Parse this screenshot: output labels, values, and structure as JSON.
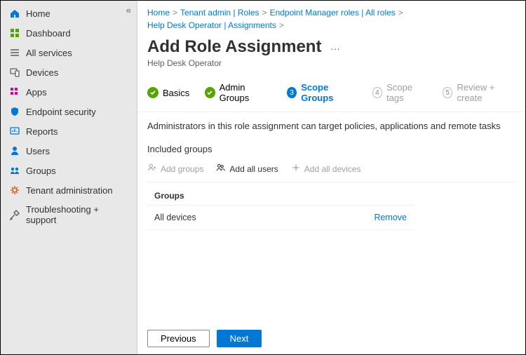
{
  "sidebar": {
    "items": [
      {
        "label": "Home",
        "icon": "home",
        "color": "#0078d4"
      },
      {
        "label": "Dashboard",
        "icon": "dashboard",
        "color": "#57a300"
      },
      {
        "label": "All services",
        "icon": "allservices",
        "color": "#605e5c"
      },
      {
        "label": "Devices",
        "icon": "devices",
        "color": "#605e5c"
      },
      {
        "label": "Apps",
        "icon": "apps",
        "color": "#e3008c"
      },
      {
        "label": "Endpoint security",
        "icon": "shield",
        "color": "#0078d4"
      },
      {
        "label": "Reports",
        "icon": "reports",
        "color": "#0078d4"
      },
      {
        "label": "Users",
        "icon": "users",
        "color": "#0078d4"
      },
      {
        "label": "Groups",
        "icon": "groups",
        "color": "#0078d4"
      },
      {
        "label": "Tenant administration",
        "icon": "tenant",
        "color": "#d83b01"
      },
      {
        "label": "Troubleshooting + support",
        "icon": "tools",
        "color": "#605e5c"
      }
    ]
  },
  "breadcrumb": [
    "Home",
    "Tenant admin | Roles",
    "Endpoint Manager roles | All roles",
    "Help Desk Operator | Assignments"
  ],
  "header": {
    "title": "Add Role Assignment",
    "subtitle": "Help Desk Operator"
  },
  "steps": [
    {
      "num": "✓",
      "label": "Basics",
      "state": "done"
    },
    {
      "num": "✓",
      "label": "Admin Groups",
      "state": "done"
    },
    {
      "num": "3",
      "label": "Scope Groups",
      "state": "active"
    },
    {
      "num": "4",
      "label": "Scope tags",
      "state": "disabled"
    },
    {
      "num": "5",
      "label": "Review + create",
      "state": "disabled"
    }
  ],
  "content": {
    "description": "Administrators in this role assignment can target policies, applications and remote tasks",
    "section": "Included groups",
    "commands": {
      "add_groups": "Add groups",
      "add_all_users": "Add all users",
      "add_all_devices": "Add all devices"
    },
    "table": {
      "header": "Groups",
      "rows": [
        {
          "name": "All devices",
          "action": "Remove"
        }
      ]
    }
  },
  "footer": {
    "previous": "Previous",
    "next": "Next"
  }
}
